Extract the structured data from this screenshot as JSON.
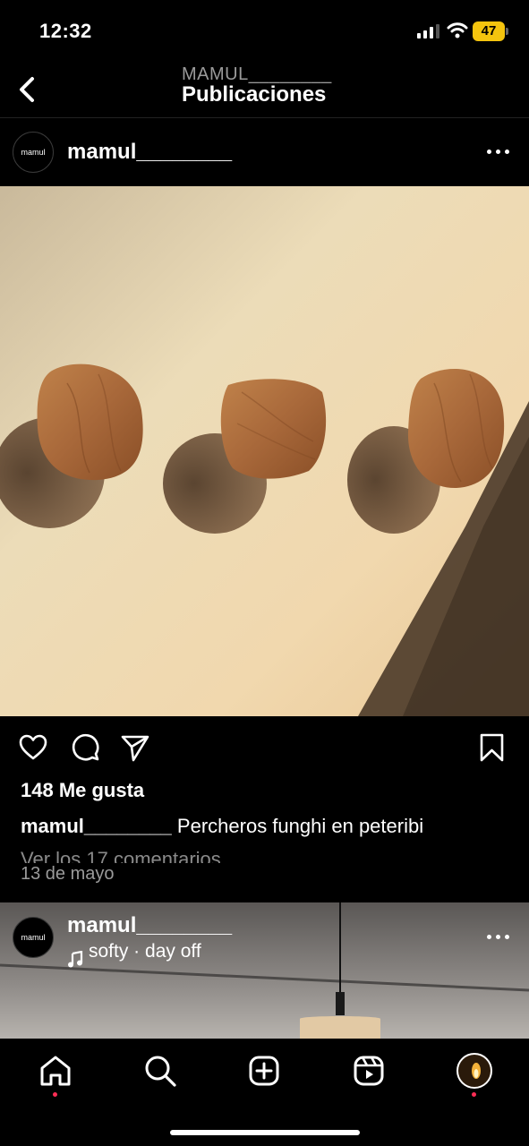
{
  "status_bar": {
    "time": "12:32",
    "battery": "47"
  },
  "header": {
    "subtitle": "MAMUL________",
    "title": "Publicaciones"
  },
  "post": {
    "avatar_text": "mamul",
    "username": "mamul________",
    "likes": "148 Me gusta",
    "caption_user": "mamul________",
    "caption_text": "Percheros funghi en peteribi",
    "comments_link": "Ver los 17 comentarios",
    "date": "13 de mayo"
  },
  "post2": {
    "avatar_text": "mamul",
    "username": "mamul________",
    "music": "softy · day off"
  },
  "icons": {
    "back": "chevron-left-icon",
    "more": "ellipsis-icon",
    "like": "heart-icon",
    "comment": "comment-icon",
    "share": "paper-plane-icon",
    "save": "bookmark-icon",
    "home": "home-icon",
    "search": "search-icon",
    "create": "plus-square-icon",
    "reels": "reels-icon",
    "profile": "profile-avatar"
  },
  "colors": {
    "notification_dot": "#ff2d55",
    "battery": "#f4c40e"
  }
}
